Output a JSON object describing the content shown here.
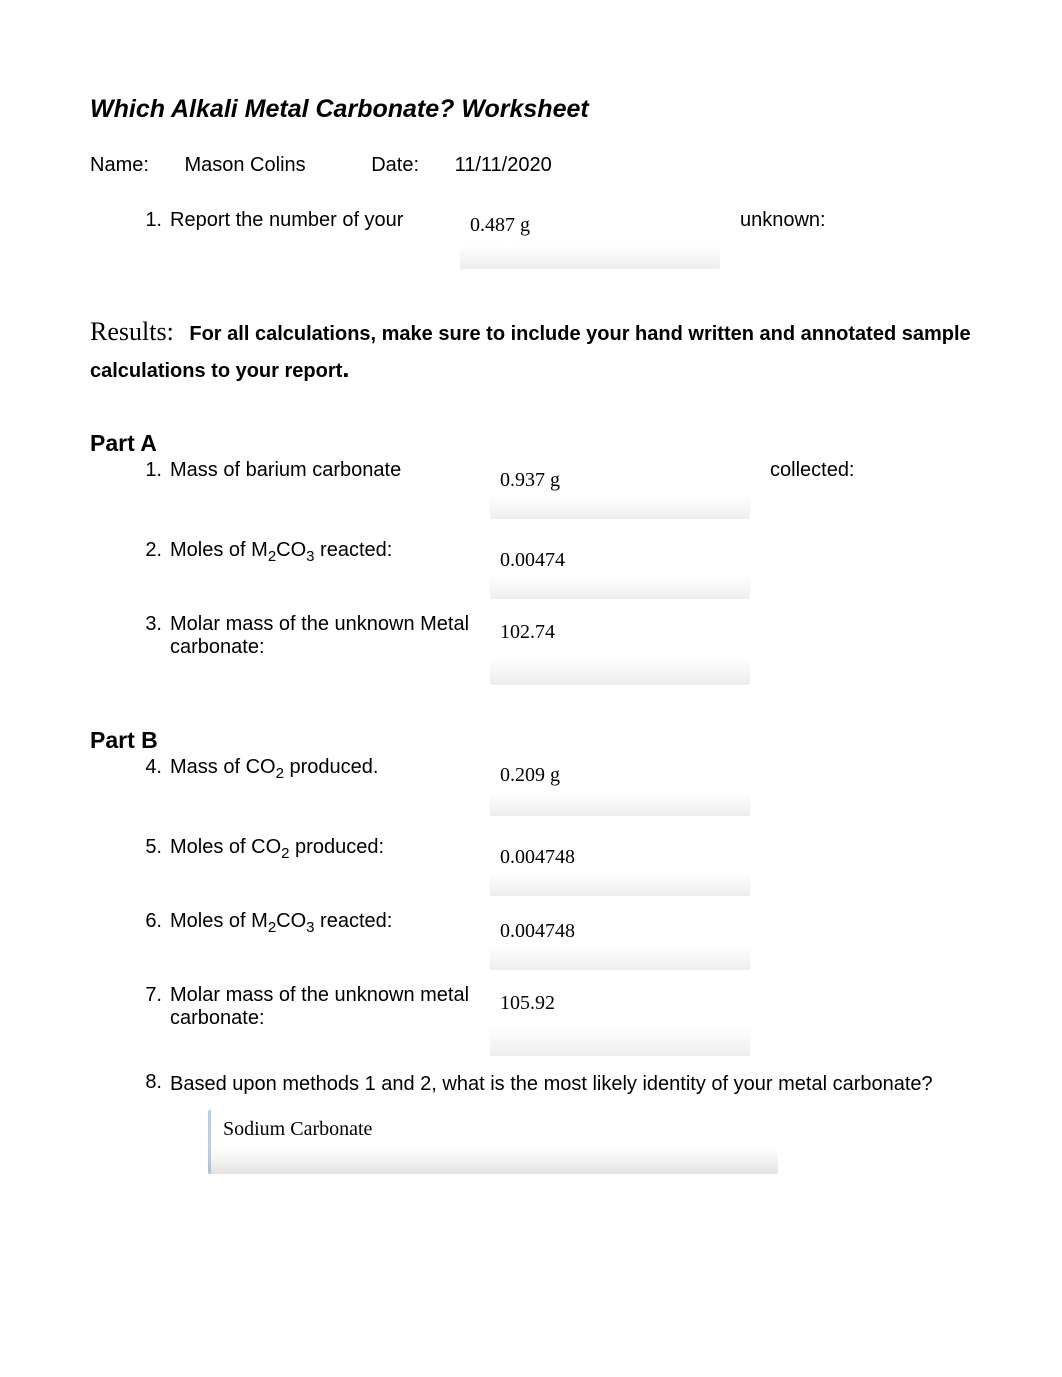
{
  "title": "Which Alkali Metal Carbonate? Worksheet",
  "name_label": "Name:",
  "name_value": "Mason Colins",
  "date_label": "Date:",
  "date_value": "11/11/2020",
  "q1": {
    "num": "1.",
    "label": "Report the number of your",
    "value": "0.487 g",
    "after": "unknown:"
  },
  "results": {
    "label": "Results:",
    "text_part1": "For all calculations, make sure to include your hand written and annotated sample calculations to your report",
    "text_part2": "."
  },
  "partA": {
    "heading": "Part A",
    "items": [
      {
        "num": "1.",
        "label_pre": "Mass of barium carbonate",
        "value": "0.937 g",
        "after": "collected:"
      },
      {
        "num": "2.",
        "label_pre": "Moles of M",
        "label_sub1": "2",
        "label_mid": "CO",
        "label_sub2": "3",
        "label_post": " reacted:",
        "value": "0.00474",
        "after": ""
      },
      {
        "num": "3.",
        "label_pre": "Molar mass of the unknown Metal carbonate:",
        "value": "102.74",
        "after": ""
      }
    ]
  },
  "partB": {
    "heading": "Part B",
    "items": [
      {
        "num": "4.",
        "label_pre": "Mass of CO",
        "label_sub1": "2",
        "label_post": " produced.",
        "value": "0.209 g",
        "after": ""
      },
      {
        "num": "5.",
        "label_pre": "Moles of CO",
        "label_sub1": "2",
        "label_post": " produced:",
        "value": "0.004748",
        "after": ""
      },
      {
        "num": "6.",
        "label_pre": "Moles of M",
        "label_sub1": "2",
        "label_mid": "CO",
        "label_sub2": "3",
        "label_post": " reacted:",
        "value": "0.004748",
        "after": ""
      },
      {
        "num": "7.",
        "label_pre": "Molar mass of the unknown metal carbonate:",
        "value": "105.92",
        "after": ""
      }
    ],
    "q8": {
      "num": "8.",
      "label": "Based upon methods 1 and 2, what is the most likely identity of your metal carbonate?",
      "value": "Sodium Carbonate"
    }
  }
}
